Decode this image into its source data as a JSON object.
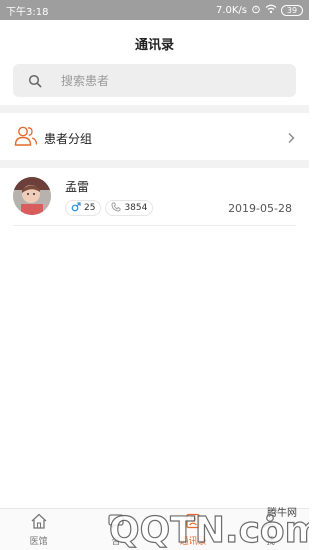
{
  "status": {
    "time": "下午3:18",
    "speed": "7.0K/s",
    "battery": "39"
  },
  "header": {
    "title": "通讯录"
  },
  "search": {
    "placeholder": "搜索患者"
  },
  "group": {
    "label": "患者分组"
  },
  "patients": [
    {
      "name": "孟雷",
      "age": "25",
      "count": "3854",
      "date": "2019-05-28"
    }
  ],
  "nav": [
    {
      "label": "医馆",
      "icon": "home-icon"
    },
    {
      "label": "咨",
      "icon": "chat-icon"
    },
    {
      "label": "通讯录",
      "icon": "contacts-icon"
    },
    {
      "label": "我",
      "icon": "user-icon"
    }
  ],
  "watermark": {
    "text": "腾牛网",
    "logo": "QQTN.com"
  },
  "colors": {
    "accent": "#e66a2c",
    "male": "#2a8fd8"
  }
}
